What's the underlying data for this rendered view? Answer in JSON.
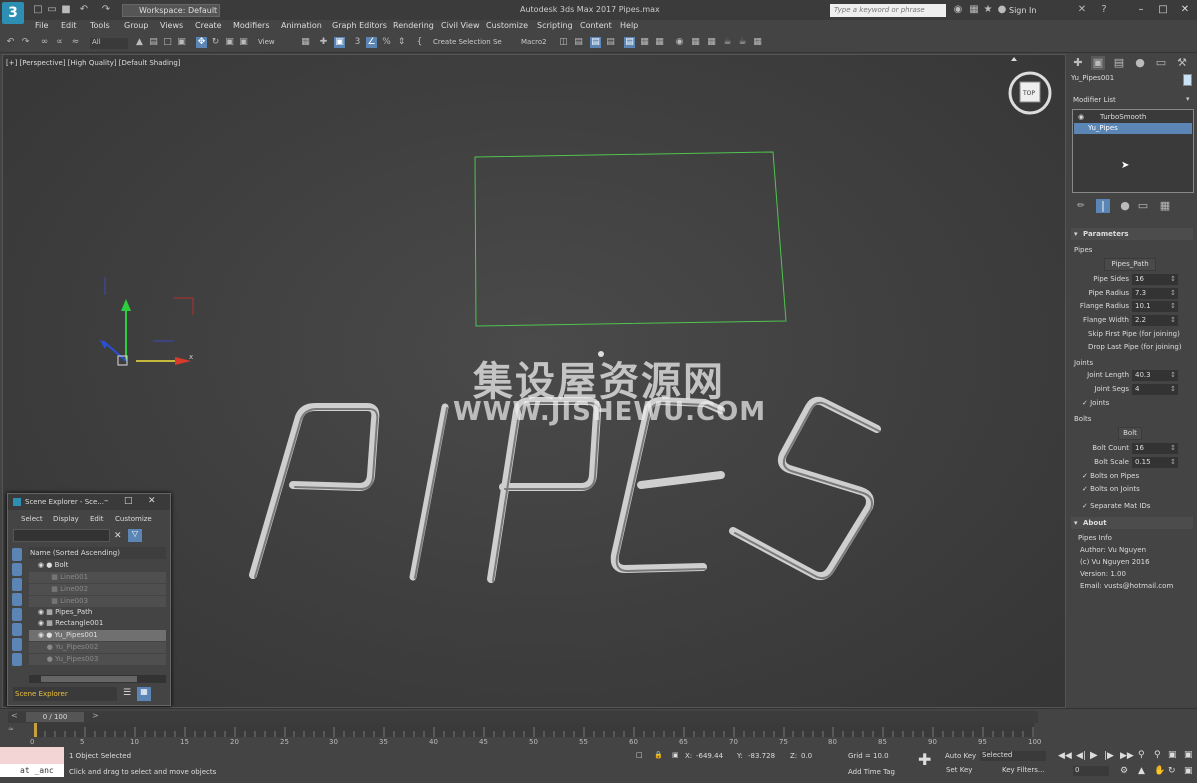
{
  "titlebar": {
    "workspace": "Workspace: Default",
    "app_title": "Autodesk 3ds Max 2017    Pipes.max",
    "search_placeholder": "Type a keyword or phrase",
    "sign_in": "Sign In",
    "logo": "3"
  },
  "menu": [
    "File",
    "Edit",
    "Tools",
    "Group",
    "Views",
    "Create",
    "Modifiers",
    "Animation",
    "Graph Editors",
    "Rendering",
    "Civil View",
    "Customize",
    "Scripting",
    "Content",
    "Help"
  ],
  "toolbar": {
    "filter": "All",
    "ref_coord": "View",
    "selection_set": "Create Selection Se",
    "macro": "Macro2"
  },
  "viewport": {
    "label": "[+] [Perspective] [High Quality] [Default Shading]",
    "watermark_cn": "集设屋资源网",
    "watermark_en": "WWW.JISHEWU.COM",
    "viewcube_label": "TOP",
    "axis_x": "x"
  },
  "command_panel": {
    "object_name": "Yu_Pipes001",
    "modifier_list_label": "Modifier List",
    "modifiers": [
      "TurboSmooth",
      "Yu_Pipes"
    ],
    "parameters": {
      "title": "Parameters",
      "pipes_group": "Pipes",
      "path_button": "Pipes_Path",
      "rows": [
        {
          "label": "Pipe Sides",
          "value": "16"
        },
        {
          "label": "Pipe Radius",
          "value": "7.3"
        },
        {
          "label": "Flange Radius",
          "value": "10.1"
        },
        {
          "label": "Flange Width",
          "value": "2.2"
        }
      ],
      "skip_first": "Skip First Pipe (for joining)",
      "drop_last": "Drop Last Pipe (for joining)",
      "joints_group": "Joints",
      "joint_rows": [
        {
          "label": "Joint Length",
          "value": "40.3"
        },
        {
          "label": "Joint Segs",
          "value": "4"
        }
      ],
      "joints_check": "Joints",
      "bolts_group": "Bolts",
      "bolt_button": "Bolt",
      "bolt_rows": [
        {
          "label": "Bolt Count",
          "value": "16"
        },
        {
          "label": "Bolt Scale",
          "value": "0.15"
        }
      ],
      "bolts_on_pipes": "Bolts on Pipes",
      "bolts_on_joints": "Bolts on Joints",
      "separate_mat": "Separate Mat IDs"
    },
    "about": {
      "title": "About",
      "info_title": "Pipes Info",
      "author": "Author: Vu Nguyen",
      "copyright": "(c) Vu Nguyen 2016",
      "version": "Version: 1.00",
      "email": "Email: vusts@hotmail.com"
    }
  },
  "scene_explorer": {
    "title": "Scene Explorer - Sce...",
    "menu": [
      "Select",
      "Display",
      "Edit",
      "Customize"
    ],
    "column": "Name (Sorted Ascending)",
    "items": [
      {
        "name": "Bolt",
        "hidden": false,
        "indent": 0
      },
      {
        "name": "Line001",
        "hidden": true,
        "indent": 1
      },
      {
        "name": "Line002",
        "hidden": true,
        "indent": 1
      },
      {
        "name": "Line003",
        "hidden": true,
        "indent": 1
      },
      {
        "name": "Pipes_Path",
        "hidden": false,
        "indent": 0
      },
      {
        "name": "Rectangle001",
        "hidden": false,
        "indent": 0
      },
      {
        "name": "Yu_Pipes001",
        "hidden": false,
        "indent": 0,
        "selected": true
      },
      {
        "name": "Yu_Pipes002",
        "hidden": true,
        "indent": 0
      },
      {
        "name": "Yu_Pipes003",
        "hidden": true,
        "indent": 0
      }
    ],
    "footer": "Scene Explorer"
  },
  "timeline": {
    "frame": "0 / 100",
    "ticks": [
      "0",
      "5",
      "10",
      "15",
      "20",
      "25",
      "30",
      "35",
      "40",
      "45",
      "50",
      "55",
      "60",
      "65",
      "70",
      "75",
      "80",
      "85",
      "90",
      "95",
      "100"
    ]
  },
  "status": {
    "mini_listener": "at _anc",
    "selected": "1 Object Selected",
    "prompt": "Click and drag to select and move objects",
    "x": "-649.44",
    "y": "-83.728",
    "z": "0.0",
    "grid": "Grid = 10.0",
    "add_time_tag": "Add Time Tag",
    "auto_key": "Auto Key",
    "selected_dropdown": "Selected",
    "set_key": "Set Key",
    "key_filters": "Key Filters...",
    "frame_field": "0"
  }
}
